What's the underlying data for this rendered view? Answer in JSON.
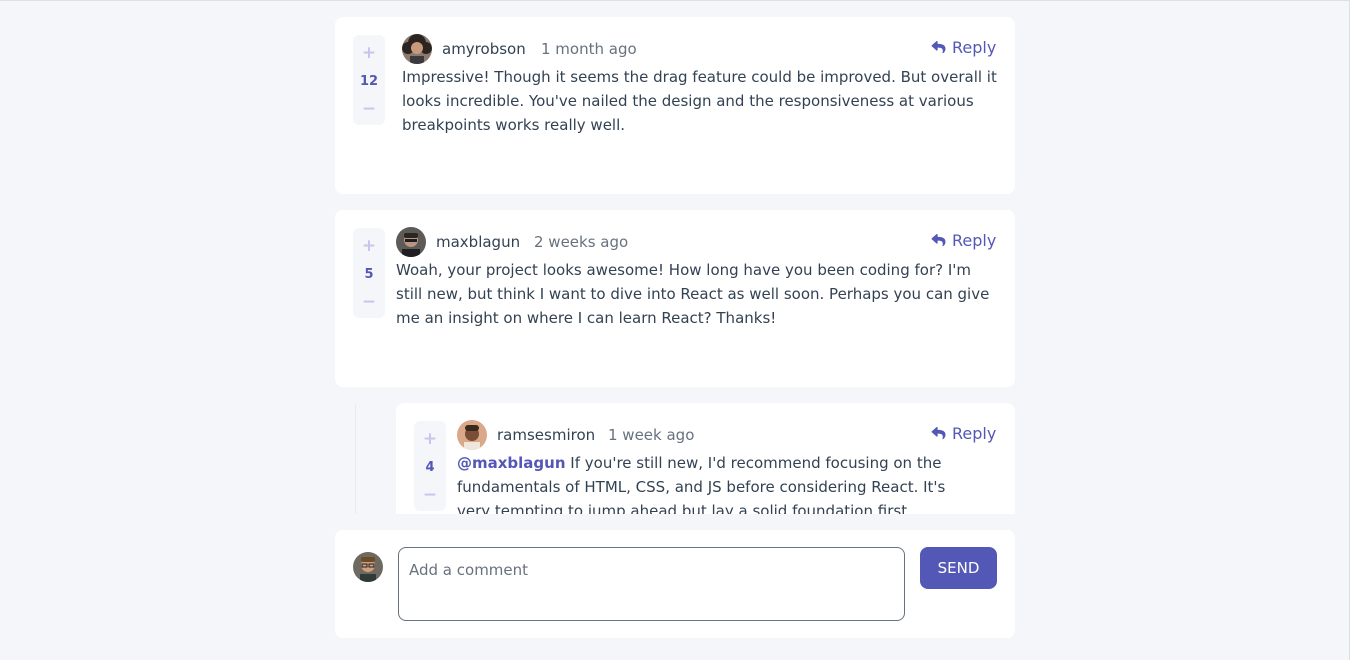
{
  "comments": [
    {
      "username": "amyrobson",
      "time": "1 month ago",
      "score": "12",
      "reply_label": "Reply",
      "content": "Impressive! Though it seems the drag feature could be improved. But overall it looks incredible. You've nailed the design and the responsiveness at various breakpoints works really well."
    },
    {
      "username": "maxblagun",
      "time": "2 weeks ago",
      "score": "5",
      "reply_label": "Reply",
      "content": "Woah, your project looks awesome! How long have you been coding for? I'm still new, but think I want to dive into React as well soon. Perhaps you can give me an insight on where I can learn React? Thanks!"
    }
  ],
  "replies": [
    {
      "username": "ramsesmiron",
      "time": "1 week ago",
      "score": "4",
      "reply_label": "Reply",
      "mention": "@maxblagun",
      "content": " If you're still new, I'd recommend focusing on the fundamentals of HTML, CSS, and JS before considering React. It's very tempting to jump ahead but lay a solid foundation first."
    }
  ],
  "vote": {
    "plus": "+",
    "minus": "−"
  },
  "composer": {
    "placeholder": "Add a comment",
    "send_label": "SEND"
  },
  "colors": {
    "accent": "#5357b6",
    "accent_light": "#c5c6ef",
    "background": "#f5f6fa",
    "text_dark": "#334253",
    "text_muted": "#67727e"
  },
  "icons": {
    "reply": "reply-arrow-icon",
    "avatar": "user-avatar-icon"
  }
}
